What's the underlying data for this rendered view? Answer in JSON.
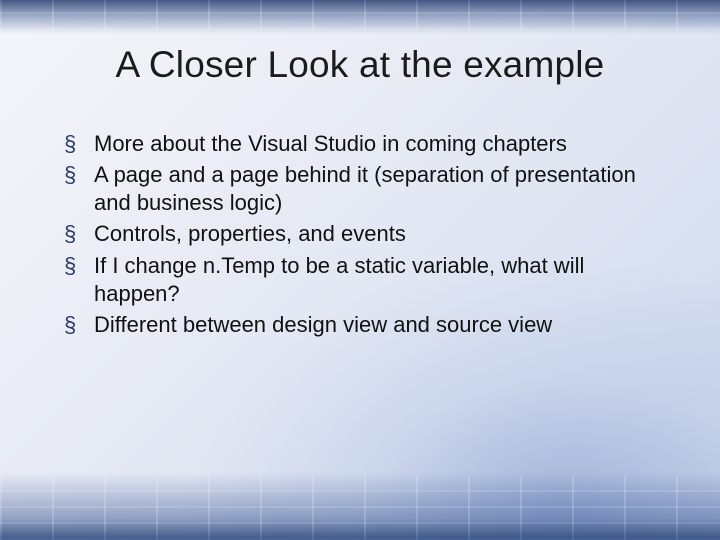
{
  "slide": {
    "title": "A Closer Look at the example",
    "bullets": [
      "More about the Visual Studio in coming chapters",
      "A page and a page behind it (separation of presentation and business logic)",
      "Controls, properties, and events",
      "If I change n.Temp to be a static variable, what will happen?",
      "Different between design view and source view"
    ]
  }
}
